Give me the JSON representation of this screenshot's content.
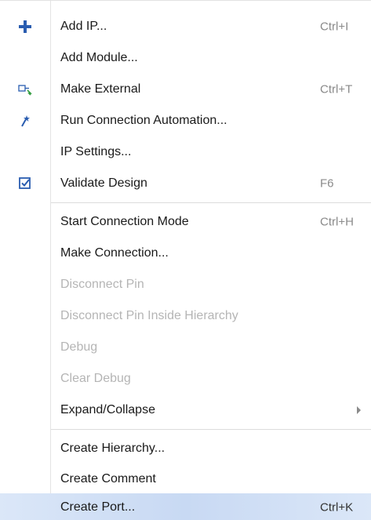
{
  "menu": {
    "items": [
      {
        "label": "Add IP...",
        "shortcut": "Ctrl+I",
        "icon": "plus-icon"
      },
      {
        "label": "Add Module...",
        "shortcut": ""
      },
      {
        "label": "Make External",
        "shortcut": "Ctrl+T",
        "icon": "make-external-icon"
      },
      {
        "label": "Run Connection Automation...",
        "shortcut": "",
        "icon": "wand-icon"
      },
      {
        "label": "IP Settings...",
        "shortcut": ""
      },
      {
        "label": "Validate Design",
        "shortcut": "F6",
        "icon": "validate-checkbox-icon"
      },
      {
        "label": "Start Connection Mode",
        "shortcut": "Ctrl+H"
      },
      {
        "label": "Make Connection...",
        "shortcut": ""
      },
      {
        "label": "Disconnect Pin",
        "shortcut": "",
        "disabled": true
      },
      {
        "label": "Disconnect Pin Inside Hierarchy",
        "shortcut": "",
        "disabled": true
      },
      {
        "label": "Debug",
        "shortcut": "",
        "disabled": true
      },
      {
        "label": "Clear Debug",
        "shortcut": "",
        "disabled": true
      },
      {
        "label": "Expand/Collapse",
        "shortcut": "",
        "submenu": true
      },
      {
        "label": "Create Hierarchy...",
        "shortcut": ""
      },
      {
        "label": "Create Comment",
        "shortcut": ""
      },
      {
        "label": "Create Port...",
        "shortcut": "Ctrl+K",
        "highlighted": true
      }
    ]
  },
  "colors": {
    "accent_blue": "#2a5db0",
    "highlight": "#cfdef5",
    "disabled_text": "#b5b5b5"
  }
}
